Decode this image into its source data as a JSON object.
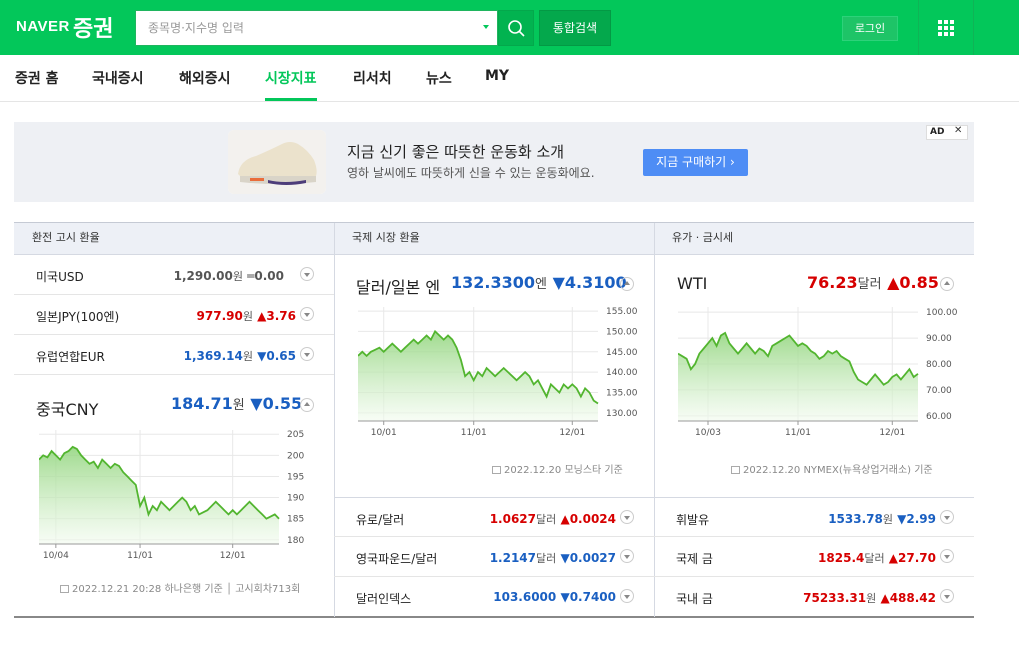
{
  "header": {
    "logo_naver": "NAVER",
    "logo_stock": "증권",
    "search_placeholder": "종목명·지수명 입력",
    "integrated_search": "통합검색",
    "login": "로그인"
  },
  "nav": {
    "items": [
      "증권 홈",
      "국내증시",
      "해외증시",
      "시장지표",
      "리서치",
      "뉴스",
      "MY"
    ],
    "active_index": 3
  },
  "ad": {
    "title": "지금 신기 좋은 따뜻한 운동화 소개",
    "desc": "영하 날씨에도 따뜻하게 신을 수 있는 운동화에요.",
    "cta": "지금 구매하기 ›",
    "badge": "AD"
  },
  "exchange": {
    "header": "환전 고시 환율",
    "rows": [
      {
        "name": "미국USD",
        "value": "1,290.00",
        "unit": "원",
        "change": "0.00",
        "dir": "flat"
      },
      {
        "name": "일본JPY(100엔)",
        "value": "977.90",
        "unit": "원",
        "change": "3.76",
        "dir": "up"
      },
      {
        "name": "유럽연합EUR",
        "value": "1,369.14",
        "unit": "원",
        "change": "0.65",
        "dir": "down"
      }
    ],
    "featured": {
      "name": "중국CNY",
      "value": "184.71",
      "unit": "원",
      "change": "0.55",
      "dir": "down"
    },
    "source_date": "2022.12.21 20:28",
    "source_name": "하나은행 기준",
    "source_round": "고시회차713회"
  },
  "intl": {
    "header": "국제 시장 환율",
    "featured": {
      "name": "달러/일본 엔",
      "value": "132.3300",
      "unit": "엔",
      "change": "4.3100",
      "dir": "down"
    },
    "source_date": "2022.12.20",
    "source_name": "모닝스타 기준",
    "rows": [
      {
        "name": "유로/달러",
        "value": "1.0627",
        "unit": "달러",
        "change": "0.0024",
        "dir": "up"
      },
      {
        "name": "영국파운드/달러",
        "value": "1.2147",
        "unit": "달러",
        "change": "0.0027",
        "dir": "down"
      },
      {
        "name": "달러인덱스",
        "value": "103.6000",
        "unit": "",
        "change": "0.7400",
        "dir": "down"
      }
    ]
  },
  "oil": {
    "header": "유가 · 금시세",
    "featured": {
      "name": "WTI",
      "value": "76.23",
      "unit": "달러",
      "change": "0.85",
      "dir": "up"
    },
    "source_date": "2022.12.20",
    "source_name": "NYMEX(뉴욕상업거래소) 기준",
    "rows": [
      {
        "name": "휘발유",
        "value": "1533.78",
        "unit": "원",
        "change": "2.99",
        "dir": "down"
      },
      {
        "name": "국제 금",
        "value": "1825.4",
        "unit": "달러",
        "change": "27.70",
        "dir": "up"
      },
      {
        "name": "국내 금",
        "value": "75233.31",
        "unit": "원",
        "change": "488.42",
        "dir": "up"
      }
    ]
  },
  "chart_data": [
    {
      "type": "area",
      "title": "중국CNY",
      "x_ticks": [
        "10/04",
        "11/01",
        "12/01"
      ],
      "x_tick_index": [
        4,
        24,
        46
      ],
      "y_ticks": [
        180,
        185,
        190,
        195,
        200,
        205
      ],
      "ylim": [
        179,
        206
      ],
      "values": [
        199,
        200,
        199.5,
        201,
        200,
        199,
        200.5,
        201,
        202,
        201.5,
        200,
        199,
        198,
        198.5,
        197,
        199,
        198,
        197,
        198,
        197.5,
        196,
        195,
        194,
        193,
        188,
        190,
        186,
        188,
        187,
        189,
        188,
        187,
        188,
        189,
        190,
        189,
        187,
        188,
        186,
        186.5,
        187,
        188,
        189,
        188,
        187,
        186,
        187,
        186,
        187,
        188,
        189,
        188,
        187,
        186,
        185,
        185.5,
        186,
        185
      ]
    },
    {
      "type": "area",
      "title": "달러/일본 엔",
      "x_ticks": [
        "10/01",
        "11/01",
        "12/01"
      ],
      "x_tick_index": [
        6,
        27,
        50
      ],
      "y_ticks": [
        130,
        135,
        140,
        145,
        150,
        155
      ],
      "ylim": [
        128,
        156
      ],
      "values": [
        144,
        145,
        144,
        145,
        145.5,
        146,
        145,
        146,
        147,
        146,
        145,
        146,
        147,
        148,
        147,
        148,
        149,
        148,
        150,
        149,
        148,
        149,
        148,
        146,
        143,
        139,
        140,
        138,
        140,
        139,
        141,
        140,
        139,
        140,
        141,
        140,
        139,
        138,
        139,
        140,
        139,
        137,
        138,
        136,
        134,
        137,
        136,
        135,
        137,
        136,
        137,
        136,
        134,
        136,
        135,
        133,
        132.3
      ]
    },
    {
      "type": "area",
      "title": "WTI",
      "x_ticks": [
        "10/03",
        "11/01",
        "12/01"
      ],
      "x_tick_index": [
        7,
        28,
        50
      ],
      "y_ticks": [
        60,
        70,
        80,
        90,
        100
      ],
      "ylim": [
        58,
        102
      ],
      "values": [
        84,
        83,
        82,
        78,
        80,
        84,
        86,
        88,
        90,
        87,
        91,
        92,
        88,
        86,
        84,
        86,
        88,
        86,
        84,
        86,
        85,
        83,
        87,
        88,
        89,
        90,
        91,
        89,
        87,
        88,
        87,
        85,
        84,
        82,
        83,
        85,
        84,
        85,
        83,
        82,
        81,
        77,
        74,
        73,
        72,
        74,
        76,
        74,
        72,
        73,
        75,
        76,
        74,
        76,
        78,
        75,
        76.23
      ]
    }
  ]
}
